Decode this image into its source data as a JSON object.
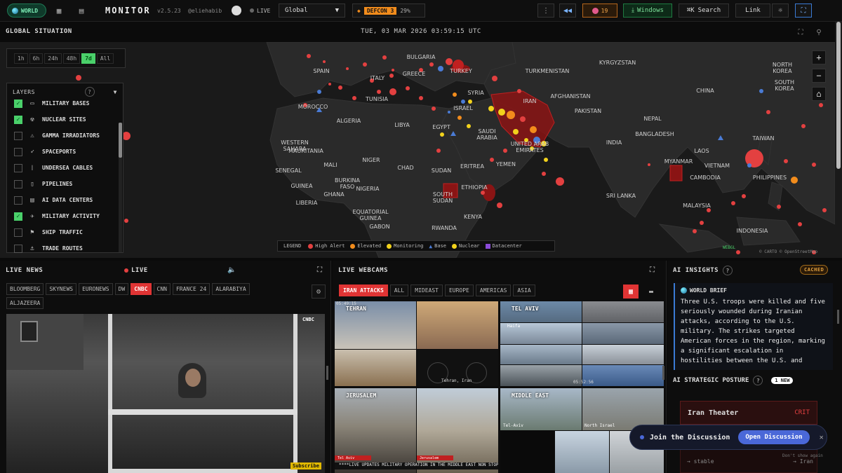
{
  "topbar": {
    "world_label": "WORLD",
    "brand": "MONITOR",
    "version": "v2.5.23",
    "handle": "@eliehabib",
    "live_label": "LIVE",
    "region_value": "Global",
    "defcon_label": "DEFCON 3",
    "defcon_percent": "29%",
    "alerts_count": "19",
    "windows_label": "Windows",
    "search_label": "Search",
    "link_label": "Link"
  },
  "map": {
    "title": "GLOBAL SITUATION",
    "clock": "TUE, 03 MAR 2026 03:59:15 UTC",
    "time_ranges": [
      "1h",
      "6h",
      "24h",
      "48h",
      "7d",
      "All"
    ],
    "active_range": "7d",
    "layers_title": "LAYERS",
    "layers": [
      {
        "label": "MILITARY BASES",
        "checked": true,
        "icon": "barracks-icon"
      },
      {
        "label": "NUCLEAR SITES",
        "checked": true,
        "icon": "radiation-icon"
      },
      {
        "label": "GAMMA IRRADIATORS",
        "checked": false,
        "icon": "warning-icon"
      },
      {
        "label": "SPACEPORTS",
        "checked": false,
        "icon": "rocket-icon"
      },
      {
        "label": "UNDERSEA CABLES",
        "checked": false,
        "icon": "cable-icon"
      },
      {
        "label": "PIPELINES",
        "checked": false,
        "icon": "pipeline-icon"
      },
      {
        "label": "AI DATA CENTERS",
        "checked": false,
        "icon": "server-icon"
      },
      {
        "label": "MILITARY ACTIVITY",
        "checked": true,
        "icon": "plane-icon"
      },
      {
        "label": "SHIP TRAFFIC",
        "checked": false,
        "icon": "ship-flag-icon"
      },
      {
        "label": "TRADE ROUTES",
        "checked": false,
        "icon": "anchor-icon"
      }
    ],
    "legend_title": "LEGEND",
    "legend": [
      {
        "label": "High Alert",
        "color": "#e34040"
      },
      {
        "label": "Elevated",
        "color": "#f28c1c"
      },
      {
        "label": "Monitoring",
        "color": "#f2d21c"
      },
      {
        "label": "Base",
        "color": "#4a7bd5"
      },
      {
        "label": "Nuclear",
        "color": "#f2d21c"
      },
      {
        "label": "Datacenter",
        "color": "#8a4ad8"
      }
    ],
    "attribution": "© CARTO © OpenStreetMap",
    "webgl": "WEBGL",
    "countries": [
      "BULGARIA",
      "TURKMENISTAN",
      "KYRGYZSTAN",
      "NORTH KOREA",
      "SPAIN",
      "ITALY",
      "GREECE",
      "TURKEY",
      "SOUTH KOREA",
      "SYRIA",
      "AFGHANISTAN",
      "CHINA",
      "TUNISIA",
      "MOROCCO",
      "ISRAEL",
      "IRAN",
      "PAKISTAN",
      "NEPAL",
      "ALGERIA",
      "LIBYA",
      "EGYPT",
      "SAUDI ARABIA",
      "UNITED ARAB EMIRATES",
      "BANGLADESH",
      "TAIWAN",
      "WESTERN SAHARA",
      "INDIA",
      "MYANMAR",
      "LAOS",
      "MAURITANIA",
      "MALI",
      "NIGER",
      "CHAD",
      "SUDAN",
      "ERITREA",
      "YEMEN",
      "VIETNAM",
      "SENEGAL",
      "BURKINA FASO",
      "NIGERIA",
      "ETHIOPIA",
      "CAMBODIA",
      "PHILIPPINES",
      "GUINEA",
      "GHANA",
      "SOUTH SUDAN",
      "SRI LANKA",
      "LIBERIA",
      "EQUATORIAL GUINEA",
      "KENYA",
      "MALAYSIA",
      "INDONESIA",
      "GABON",
      "RWANDA"
    ]
  },
  "news": {
    "title": "LIVE NEWS",
    "live": "LIVE",
    "channels": [
      "BLOOMBERG",
      "SKYNEWS",
      "EURONEWS",
      "DW",
      "CNBC",
      "CNN",
      "FRANCE 24",
      "ALARABIYA",
      "ALJAZEERA"
    ],
    "active_channel": "CNBC",
    "video_logo": "CNBC",
    "subscribe": "Subscribe"
  },
  "webcams": {
    "title": "LIVE WEBCAMS",
    "tabs": [
      "IRAN ATTACKS",
      "ALL",
      "MIDEAST",
      "EUROPE",
      "AMERICAS",
      "ASIA"
    ],
    "active_tab": "IRAN ATTACKS",
    "cams": [
      "TEHRAN",
      "TEL AVIV",
      "JERUSALEM",
      "MIDDLE EAST"
    ],
    "ticker": "****LIVE UPDATES MILITARY OPERATION IN THE MIDDLE EAST NON STOP MI",
    "overlay_times": [
      "05:49:15",
      "05:52:56"
    ],
    "overlay_labels": [
      "Tehran, Iran",
      "Haifa",
      "Tel-Aviv",
      "North Israel",
      "Tel Aviv",
      "Jerusalem"
    ]
  },
  "insights": {
    "title": "AI INSIGHTS",
    "cached": "CACHED",
    "brief_title": "WORLD BRIEF",
    "brief_text": "Three U.S. troops were killed and five seriously wounded during Iranian attacks, according to the U.S. military. The strikes targeted American forces in the region, marking a significant escalation in hostilities between the U.S. and",
    "posture_title": "AI STRATEGIC POSTURE",
    "new_badge": "1 NEW",
    "theater": "Iran Theater",
    "theater_level": "CRIT",
    "stable": "→ stable",
    "iran": "→ Iran"
  },
  "discussion": {
    "label": "Join the Discussion",
    "button": "Open Discussion",
    "dont_show": "Don't show again"
  }
}
